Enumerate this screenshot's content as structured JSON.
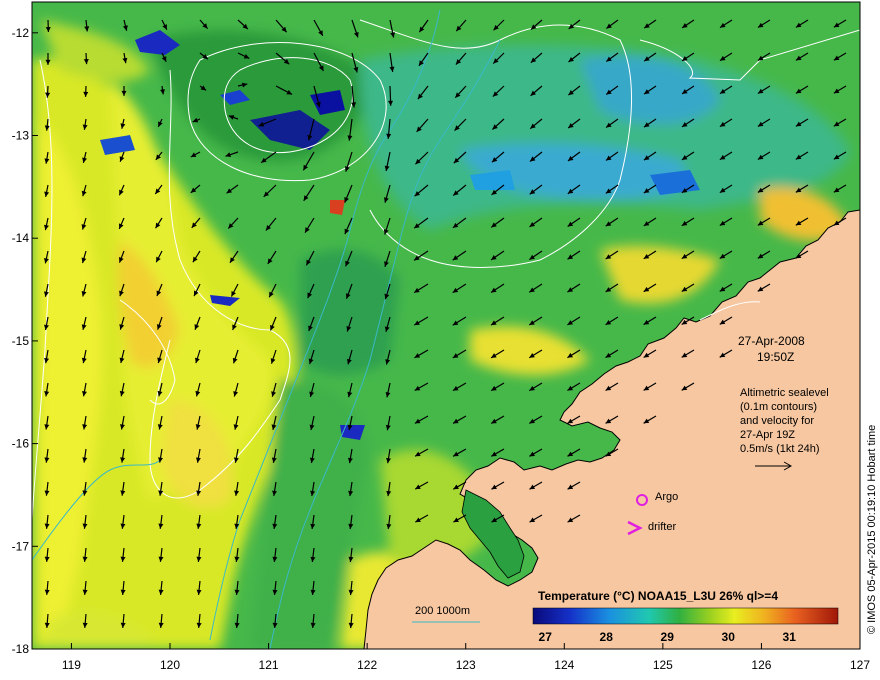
{
  "map": {
    "lon_ticks": [
      "119",
      "120",
      "121",
      "122",
      "123",
      "124",
      "125",
      "126",
      "127"
    ],
    "lat_ticks": [
      "-12",
      "-13",
      "-14",
      "-15",
      "-16",
      "-17",
      "-18"
    ],
    "lon_range": [
      118.6,
      127.0
    ],
    "lat_range": [
      -18.0,
      -11.7
    ]
  },
  "annotations": {
    "date": "27-Apr-2008",
    "time": "19:50Z",
    "desc_line1": "Altimetric sealevel",
    "desc_line2": "(0.1m contours)",
    "desc_line3": "and velocity for",
    "desc_line4": "27-Apr 19Z",
    "desc_line5": "0.5m/s (1kt 24h)"
  },
  "legend": {
    "argo": "Argo",
    "drifter": "drifter",
    "bathy": "200  1000m"
  },
  "colorbar": {
    "title": "Temperature (°C) NOAA15_L3U 26% ql>=4",
    "ticks": [
      "27",
      "28",
      "29",
      "30",
      "31"
    ],
    "range": [
      26.8,
      31.8
    ]
  },
  "credit": "© IMOS 05-Apr-2015 00:19:10 Hobart time",
  "colors": {
    "land": "#f6c7a0",
    "contour": "#ffffff",
    "bathy": "#3ab9c8",
    "argo": "#e020e0",
    "drifter": "#e020e0"
  }
}
